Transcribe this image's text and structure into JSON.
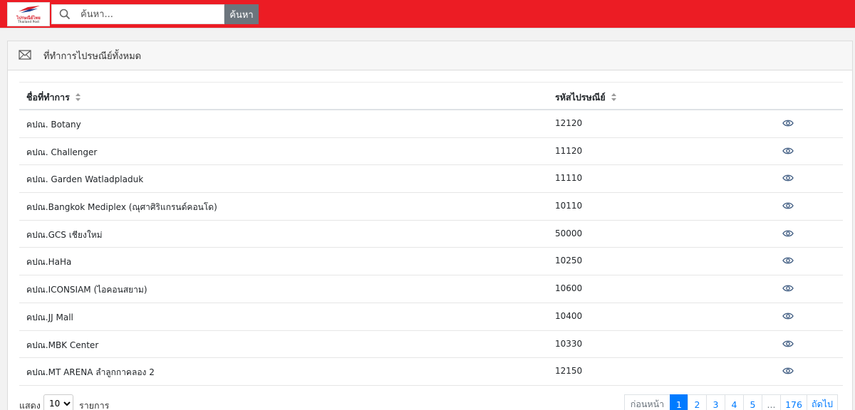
{
  "header": {
    "logo_th": "ไปรษณีย์ไทย",
    "logo_en": "Thailand Post",
    "search": {
      "placeholder": "ค้นหา...",
      "button_label": "ค้นหา"
    }
  },
  "card": {
    "title": "ที่ทำการไปรษณีย์ทั้งหมด",
    "icon": "envelope-icon"
  },
  "table": {
    "columns": [
      "ชื่อที่ทำการ",
      "รหัสไปรษณีย์"
    ],
    "rows": [
      {
        "name": "คปณ. Botany",
        "code": "12120"
      },
      {
        "name": "คปณ. Challenger",
        "code": "11120"
      },
      {
        "name": "คปณ. Garden Watladpladuk",
        "code": "11110"
      },
      {
        "name": "คปณ.Bangkok Mediplex (ณุศาศิริแกรนด์คอนโด)",
        "code": "10110"
      },
      {
        "name": "คปณ.GCS เชียงใหม่",
        "code": "50000"
      },
      {
        "name": "คปณ.HaHa",
        "code": "10250"
      },
      {
        "name": "คปณ.ICONSIAM (ไอคอนสยาม)",
        "code": "10600"
      },
      {
        "name": "คปณ.JJ Mall",
        "code": "10400"
      },
      {
        "name": "คปณ.MBK Center",
        "code": "10330"
      },
      {
        "name": "คปณ.MT ARENA ลำลูกกาคลอง 2",
        "code": "12150"
      }
    ]
  },
  "footer": {
    "show_label": "แสดง",
    "page_size": "10",
    "items_label": "รายการ"
  },
  "pagination": {
    "prev": "ก่อนหน้า",
    "pages": [
      "1",
      "2",
      "3",
      "4",
      "5",
      "...",
      "176"
    ],
    "active": "1",
    "next": "ถัดไป"
  },
  "colors": {
    "brand": "#ec1c24",
    "primary": "#007bff"
  }
}
